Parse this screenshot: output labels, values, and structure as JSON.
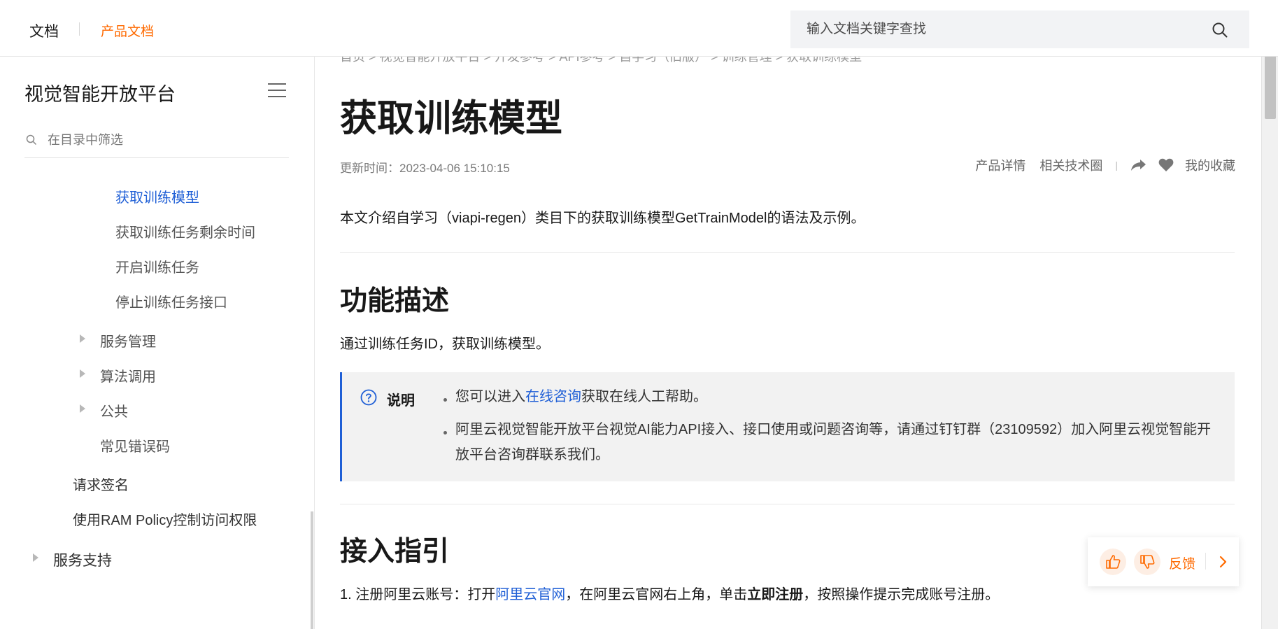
{
  "header": {
    "brand": "文档",
    "product": "产品文档",
    "search_placeholder": "输入文档关键字查找"
  },
  "sidebar": {
    "title": "视觉智能开放平台",
    "filter_placeholder": "在目录中筛选",
    "items": [
      {
        "label": "获取训练模型",
        "active": true
      },
      {
        "label": "获取训练任务剩余时间"
      },
      {
        "label": "开启训练任务"
      },
      {
        "label": "停止训练任务接口"
      },
      {
        "label": "服务管理",
        "expandable": true
      },
      {
        "label": "算法调用",
        "expandable": true
      },
      {
        "label": "公共",
        "expandable": true
      },
      {
        "label": "常见错误码"
      },
      {
        "label": "请求签名"
      },
      {
        "label": "使用RAM Policy控制访问权限"
      },
      {
        "label": "服务支持",
        "expandable": true
      }
    ]
  },
  "main": {
    "breadcrumb": "首页 > 视觉智能开放平台 > 开发参考 > API参考 > 自学习（旧版） > 训练管理 > 获取训练模型",
    "title": "获取训练模型",
    "updated": "更新时间：2023-04-06 15:10:15",
    "actions": {
      "product_detail": "产品详情",
      "tech_circle": "相关技术圈",
      "separator": "|",
      "favorite": "我的收藏"
    },
    "intro": "本文介绍自学习（viapi-regen）类目下的获取训练模型GetTrainModel的语法及示例。",
    "section1": {
      "heading": "功能描述",
      "text": "通过训练任务ID，获取训练模型。"
    },
    "note": {
      "label": "说明",
      "item1_pre": "您可以进入",
      "item1_link": "在线咨询",
      "item1_post": "获取在线人工帮助。",
      "item2": "阿里云视觉智能开放平台视觉AI能力API接入、接口使用或问题咨询等，请通过钉钉群（23109592）加入阿里云视觉智能开放平台咨询群联系我们。"
    },
    "section2": {
      "heading": "接入指引",
      "step1_pre": "1. 注册阿里云账号：打开",
      "step1_link": "阿里云官网",
      "step1_mid": "，在阿里云官网右上角，单击",
      "step1_bold": "立即注册",
      "step1_post": "，按照操作提示完成账号注册。"
    }
  },
  "feedback": {
    "label": "反馈"
  },
  "colors": {
    "accent": "#ff6a00",
    "link": "#1f5fd6",
    "note_bg": "#f2f2f2"
  }
}
